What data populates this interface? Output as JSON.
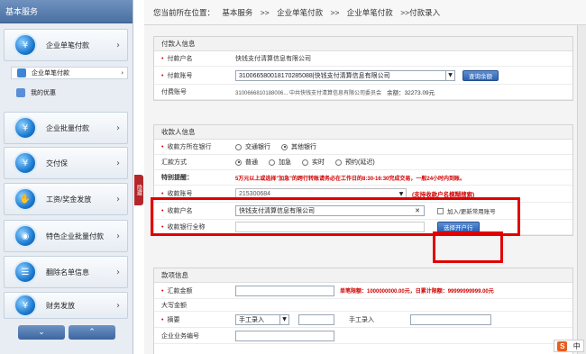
{
  "sidebar": {
    "title": "基本服务",
    "items": [
      {
        "label": "企业单笔付款",
        "icon": "yen-icon",
        "glyph": "¥"
      },
      {
        "label": "企业批量付款",
        "icon": "batch-yen-icon",
        "glyph": "¥"
      },
      {
        "label": "交付保",
        "icon": "wallet-icon",
        "glyph": "¥"
      },
      {
        "label": "工资/奖金发放",
        "icon": "hand-coin-icon",
        "glyph": "✋"
      },
      {
        "label": "特色企业批量付款",
        "icon": "globe-icon",
        "glyph": "◉"
      },
      {
        "label": "翻除名单信息",
        "icon": "list-icon",
        "glyph": "☰"
      },
      {
        "label": "财务发放",
        "icon": "finance-icon",
        "glyph": "¥"
      }
    ],
    "subitems": [
      {
        "label": "企业单笔付款"
      },
      {
        "label": "我的优惠"
      }
    ],
    "bottom_up": "⌄",
    "bottom_down": "⌃",
    "collapse_label": "隐藏"
  },
  "breadcrumb": {
    "prefix": "您当前所在位置：",
    "level1": "基本服务",
    "sep1": ">>",
    "level2": "企业单笔付款",
    "sep2": ">>",
    "level3": "企业单笔付款",
    "sep3": ">>付款录入"
  },
  "payer": {
    "title": "付款人信息",
    "name_label": "付款户名",
    "name_value": "快钱支付清算信息有限公司",
    "account_label": "付款账号",
    "account_value": "310066580018170285088|快钱支付清算信息有限公司",
    "balance_button": "查询余额",
    "acctno_label": "付费账号",
    "acctno_value": "3100666810188006... 中共快钱支付清算信息有限公司委员会",
    "balance_text": "余额：32273.09元"
  },
  "payee": {
    "title": "收款人信息",
    "bank_label": "收款方所在银行",
    "bank_opt1": "交通银行",
    "bank_opt2": "其他银行",
    "remit_label": "汇款方式",
    "remit_opt1": "普通",
    "remit_opt2": "加急",
    "remit_opt3": "实时",
    "remit_opt4": "预约(延迟)",
    "notice_label": "特别提醒：",
    "notice_text": "5万元以上或选择\"加急\"的跨行转账请务必在工作日的8:30-16:30完成交易，一般24小时内到账。",
    "account_label": "收款账号",
    "account_value": "215300684",
    "account_hint": "(支持收款户名模糊搜索)",
    "name_label": "收款户名",
    "name_value": "快钱支付清算信息有限公司",
    "add_payee_label": "加入/更新常用账号",
    "bankname_label": "收款银行全称",
    "choose_bank_button": "选择开户行"
  },
  "amount": {
    "title": "款项信息",
    "amount_label": "汇款金额",
    "amount_limit": "单笔限额：1000000000.00元，日累计限额：99999999999.00元",
    "caps_label": "大写金额",
    "summary_label": "摘要",
    "summary_select": "手工录入",
    "summary_manual": "手工录入",
    "bizno_label": "企业业务编号"
  },
  "ime": {
    "logo": "S",
    "lang": "中"
  }
}
